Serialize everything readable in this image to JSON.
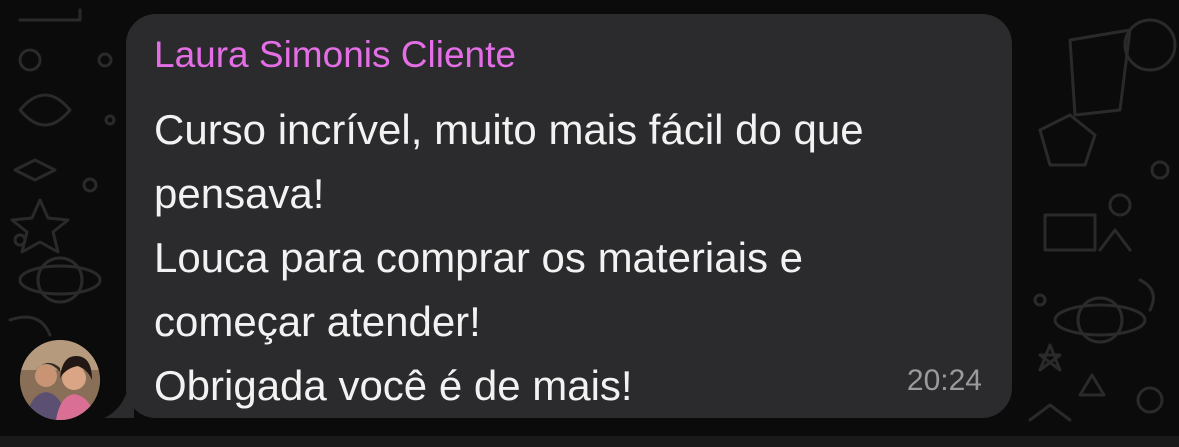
{
  "message": {
    "sender": "Laura Simonis Cliente",
    "lines": [
      "Curso incrível, muito mais fácil do que",
      "pensava!",
      "Louca para comprar os materiais e",
      "começar atender!",
      "Obrigada você é de mais!"
    ],
    "time": "20:24"
  },
  "colors": {
    "background": "#0b0b0b",
    "bubble": "#2b2b2d",
    "sender_name": "#e46ee6",
    "message_text": "#f2f2f2",
    "timestamp": "#9a9a9c"
  }
}
